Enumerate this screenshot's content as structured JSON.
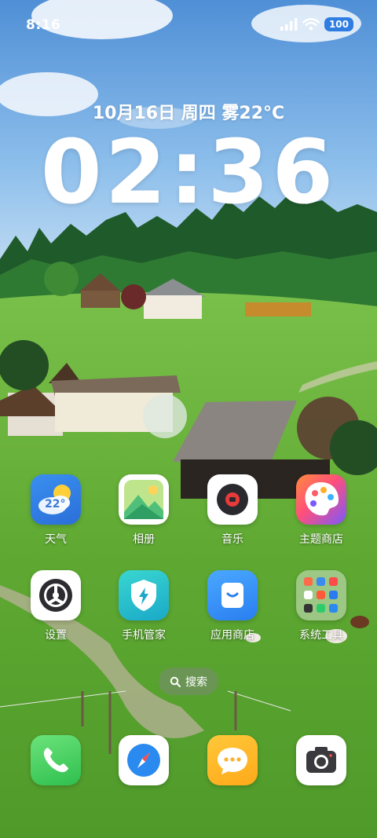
{
  "status_bar": {
    "time": "8:16",
    "battery": "100",
    "icons": [
      "signal-icon",
      "wifi-icon",
      "battery-icon"
    ]
  },
  "lockscreen": {
    "date_weather": "10月16日 周四 雾22°C",
    "clock": "02:36"
  },
  "apps": {
    "weather": {
      "label": "天气",
      "temp": "22°"
    },
    "gallery": {
      "label": "相册"
    },
    "music": {
      "label": "音乐"
    },
    "themes": {
      "label": "主题商店"
    },
    "settings": {
      "label": "设置"
    },
    "security": {
      "label": "手机管家"
    },
    "appstore": {
      "label": "应用商店"
    },
    "tools": {
      "label": "系统工具"
    }
  },
  "search": {
    "label": "搜索"
  },
  "dock": [
    "phone",
    "browser",
    "messages",
    "camera"
  ],
  "colors": {
    "battery_badge": "#2f7de1",
    "sky": "#5f9fde",
    "grass": "#5ea832"
  }
}
